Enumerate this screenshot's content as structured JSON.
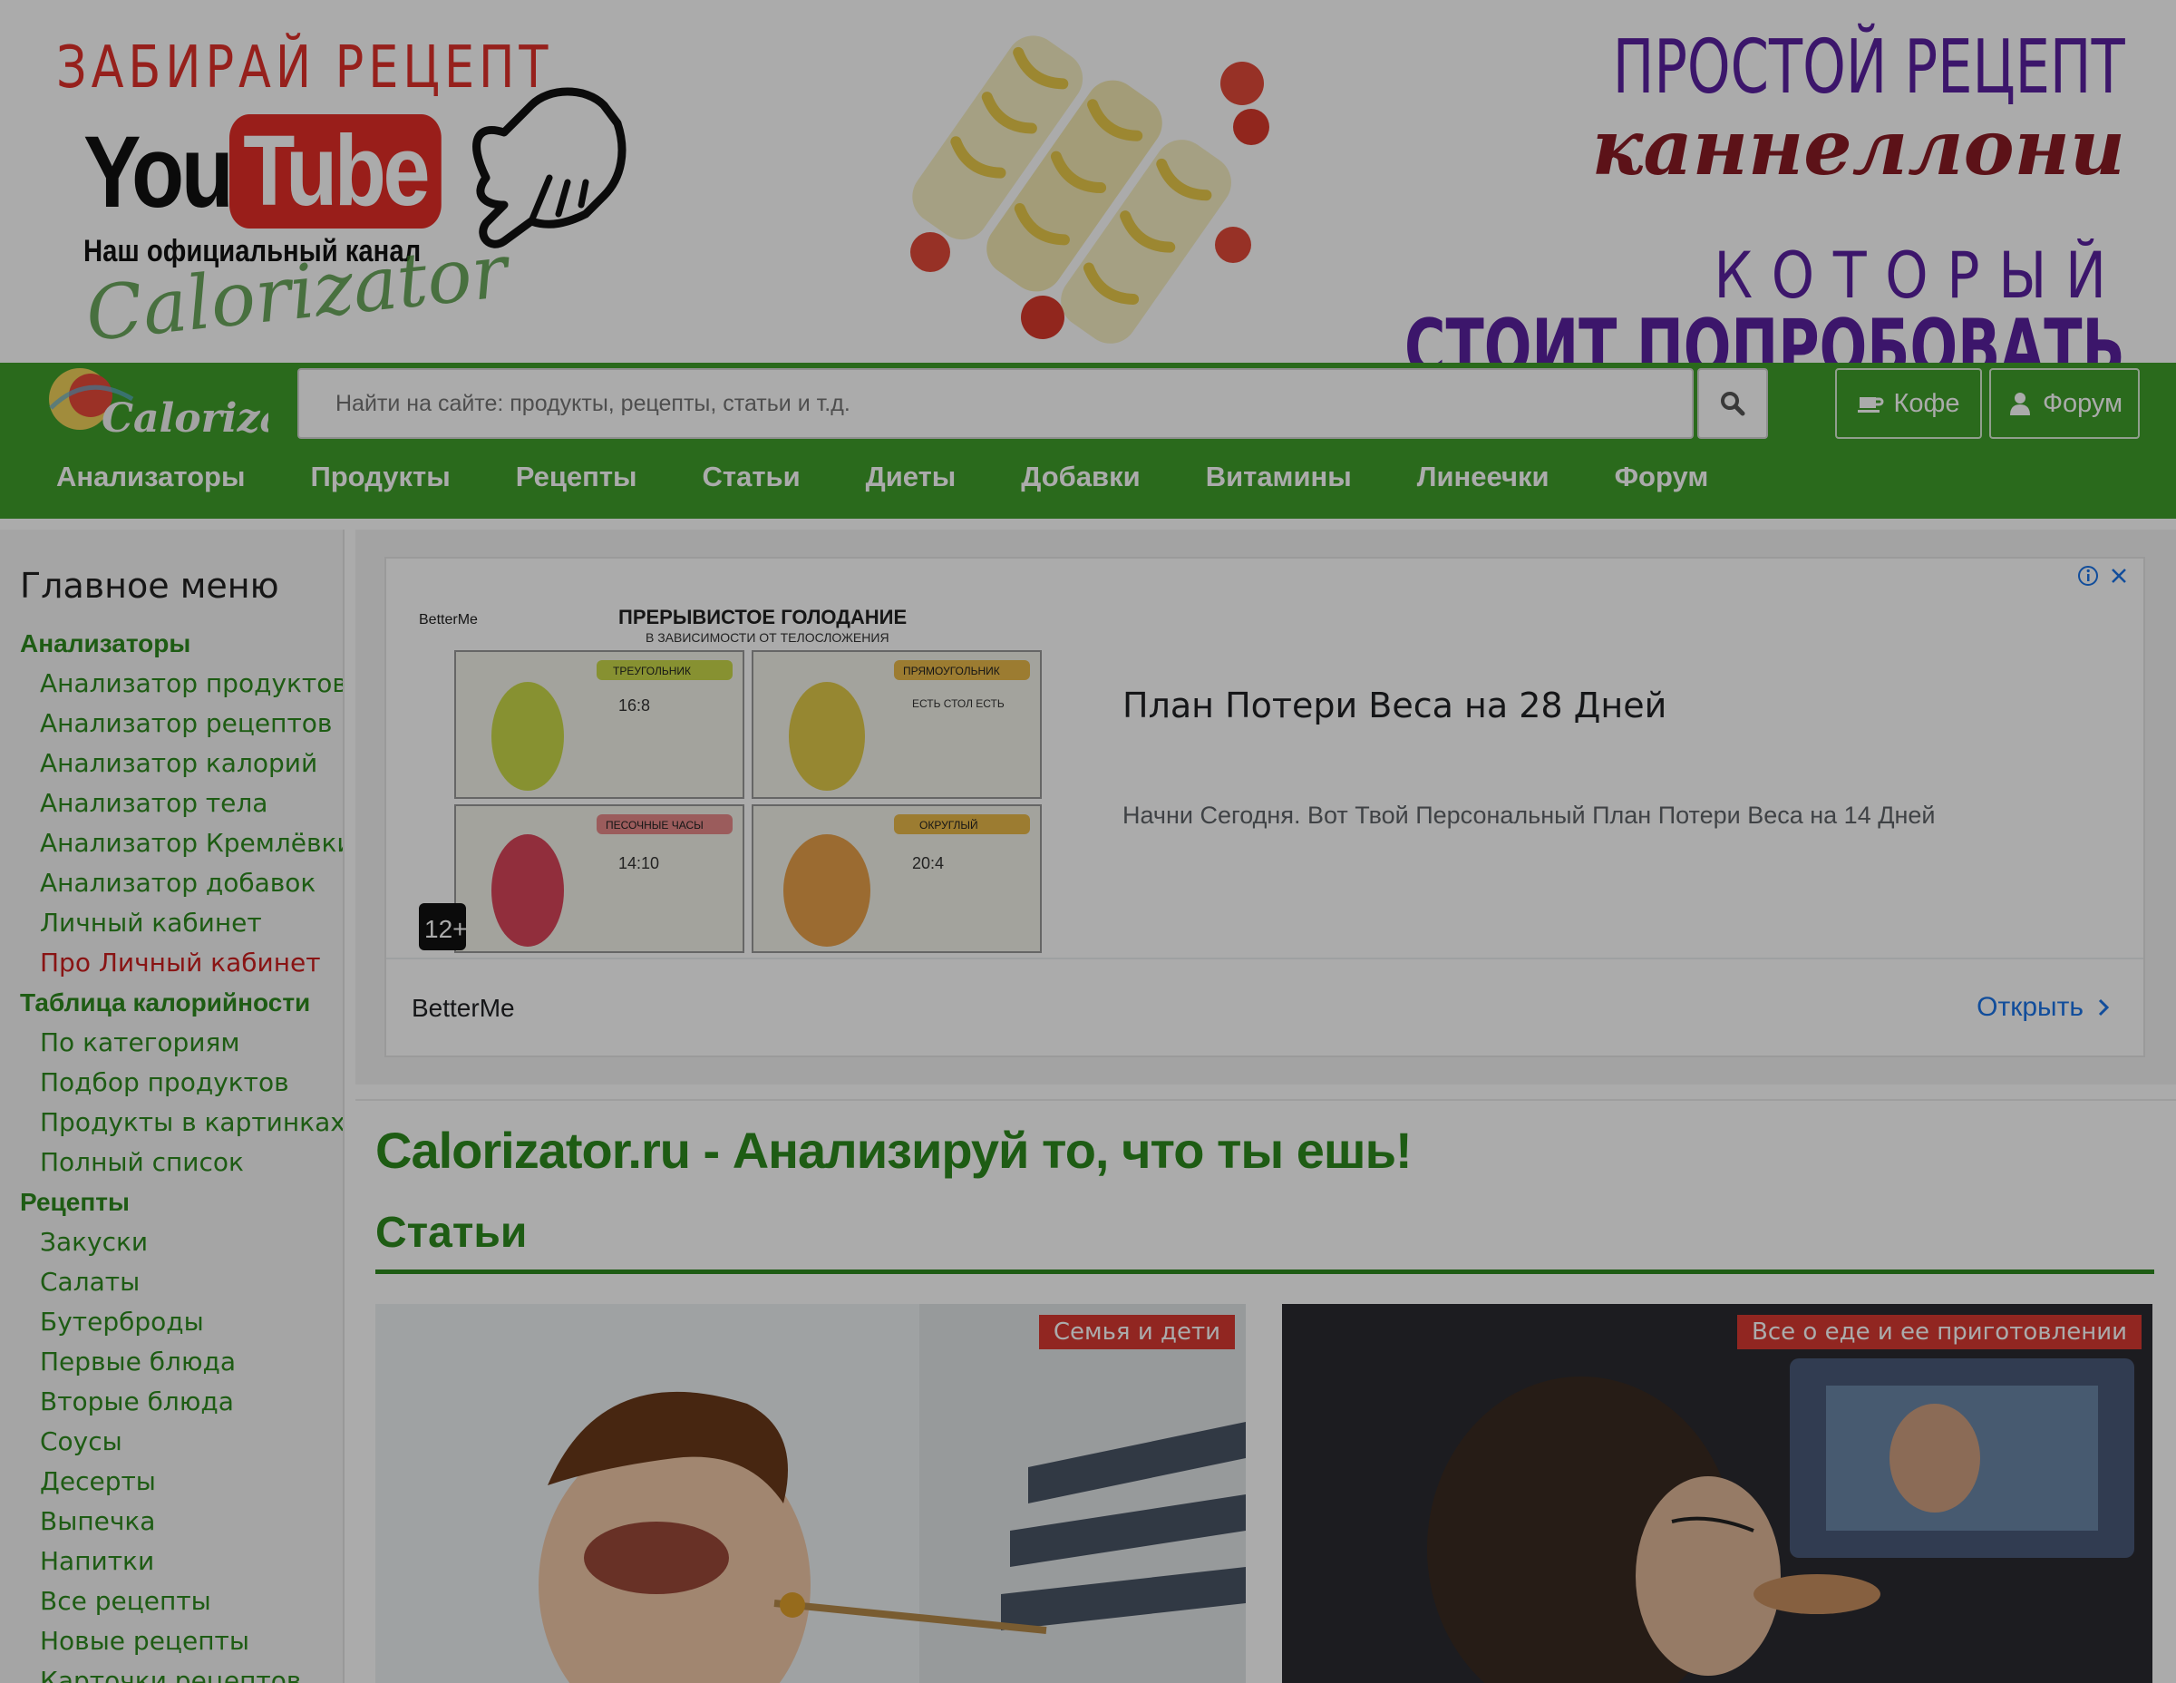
{
  "banner": {
    "left_title": "ЗАБИРАЙ РЕЦЕПТ",
    "yt_you": "You",
    "yt_tube": "Tube",
    "channel_text": "Наш официальный канал",
    "script_brand": "Calorizator",
    "right_line1": "ПРОСТОЙ РЕЦЕПТ",
    "right_line2": "каннеллони",
    "right_line3": "КОТОРЫЙ",
    "right_line4": "СТОИТ ПОПРОБОВАТЬ"
  },
  "header": {
    "logo_text": "Calorizator",
    "search_placeholder": "Найти на сайте: продукты, рецепты, статьи и т.д.",
    "coffee_label": "Кофе",
    "forum_label": "Форум",
    "nav": [
      "Анализаторы",
      "Продукты",
      "Рецепты",
      "Статьи",
      "Диеты",
      "Добавки",
      "Витамины",
      "Линеечки",
      "Форум"
    ]
  },
  "sidebar": {
    "title": "Главное меню",
    "sections": [
      {
        "label": "Анализаторы",
        "links": [
          {
            "label": "Анализатор продуктов"
          },
          {
            "label": "Анализатор рецептов"
          },
          {
            "label": "Анализатор калорий"
          },
          {
            "label": "Анализатор тела"
          },
          {
            "label": "Анализатор Кремлёвки"
          },
          {
            "label": "Анализатор добавок"
          },
          {
            "label": "Личный кабинет"
          },
          {
            "label": "Про Личный кабинет",
            "highlight": true
          }
        ]
      },
      {
        "label": "Таблица калорийности",
        "links": [
          {
            "label": "По категориям"
          },
          {
            "label": "Подбор продуктов"
          },
          {
            "label": "Продукты в картинках"
          },
          {
            "label": "Полный список"
          }
        ]
      },
      {
        "label": "Рецепты",
        "links": [
          {
            "label": "Закуски"
          },
          {
            "label": "Салаты"
          },
          {
            "label": "Бутерброды"
          },
          {
            "label": "Первые блюда"
          },
          {
            "label": "Вторые блюда"
          },
          {
            "label": "Соусы"
          },
          {
            "label": "Десерты"
          },
          {
            "label": "Выпечка"
          },
          {
            "label": "Напитки"
          },
          {
            "label": "Все рецепты"
          },
          {
            "label": "Новые рецепты"
          },
          {
            "label": "Карточки рецептов"
          }
        ]
      }
    ]
  },
  "ad": {
    "image_brand": "BetterMe",
    "image_title": "ПРЕРЫВИСТОЕ ГОЛОДАНИЕ",
    "image_subtitle": "В ЗАВИСИМОСТИ ОТ ТЕЛОСЛОЖЕНИЯ",
    "image_tiles": [
      {
        "label": "ТРЕУГОЛЬНИК",
        "value": "16:8"
      },
      {
        "label": "ПРЯМОУГОЛЬНИК",
        "value": "ЕСТЬ СТОЛ ЕСТЬ"
      },
      {
        "label": "ПЕСОЧНЫЕ ЧАСЫ",
        "value": "14:10"
      },
      {
        "label": "ОКРУГЛЫЙ",
        "value": "20:4"
      }
    ],
    "age_badge": "12+",
    "headline": "План Потери Веса на 28 Дней",
    "description": "Начни Сегодня. Вот Твой Персональный План Потери Веса на 14 Дней",
    "brand": "BetterMe",
    "open_label": "Открыть"
  },
  "main": {
    "site_heading": "Calorizator.ru - Анализируй то, что ты ешь!",
    "section_heading": "Статьи",
    "cards": [
      {
        "tag": "Семья и дети"
      },
      {
        "tag": "Все о еде и ее приготовлении"
      }
    ]
  },
  "colors": {
    "brand_green": "#3f9f2b",
    "link_green": "#2e8a1e",
    "tag_red": "#d83a32",
    "ad_link_blue": "#1a73e8"
  }
}
